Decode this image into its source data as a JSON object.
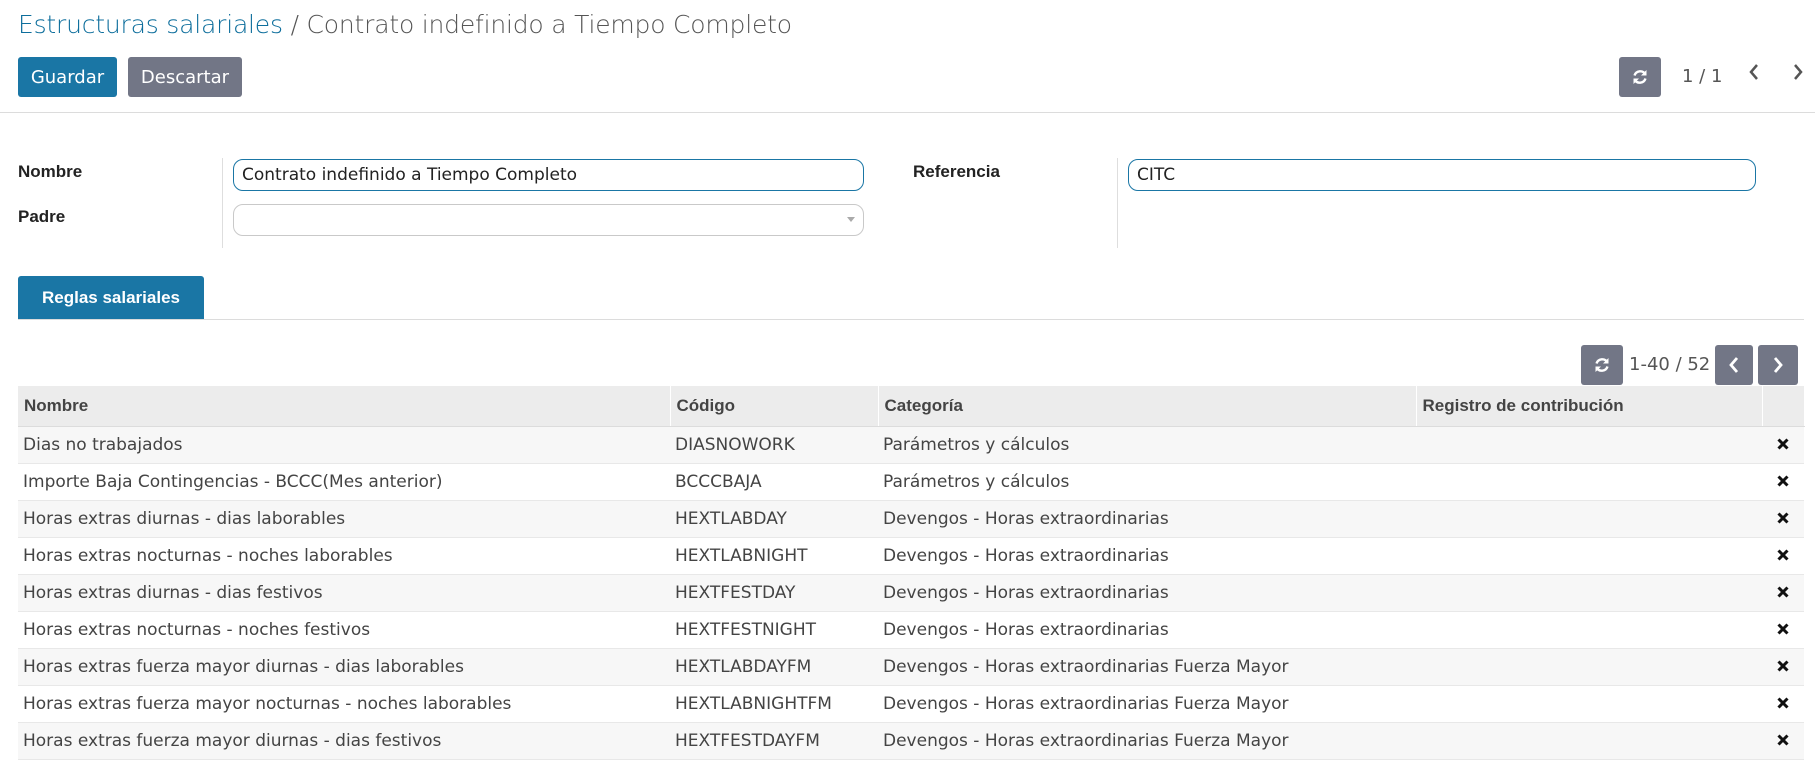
{
  "breadcrumb": {
    "parent": "Estructuras salariales",
    "separator": " / ",
    "current": "Contrato indefinido a Tiempo Completo"
  },
  "toolbar": {
    "save_label": "Guardar",
    "discard_label": "Descartar",
    "refresh_icon": "refresh-icon",
    "pager": "1 / 1"
  },
  "form": {
    "name_label": "Nombre",
    "name_value": "Contrato indefinido a Tiempo Completo",
    "parent_label": "Padre",
    "parent_value": "",
    "reference_label": "Referencia",
    "reference_value": "CITC"
  },
  "tabs": [
    {
      "label": "Reglas salariales",
      "active": true
    }
  ],
  "list": {
    "pager": "1-40 / 52",
    "columns": [
      "Nombre",
      "Código",
      "Categoría",
      "Registro de contribución",
      ""
    ],
    "rows": [
      {
        "name": "Dias no trabajados",
        "code": "DIASNOWORK",
        "category": "Parámetros y cálculos",
        "contribution": ""
      },
      {
        "name": "Importe Baja Contingencias - BCCC(Mes anterior)",
        "code": "BCCCBAJA",
        "category": "Parámetros y cálculos",
        "contribution": ""
      },
      {
        "name": "Horas extras diurnas - dias laborables",
        "code": "HEXTLABDAY",
        "category": "Devengos - Horas extraordinarias",
        "contribution": ""
      },
      {
        "name": "Horas extras nocturnas - noches laborables",
        "code": "HEXTLABNIGHT",
        "category": "Devengos - Horas extraordinarias",
        "contribution": ""
      },
      {
        "name": "Horas extras diurnas - dias festivos",
        "code": "HEXTFESTDAY",
        "category": "Devengos - Horas extraordinarias",
        "contribution": ""
      },
      {
        "name": "Horas extras nocturnas - noches festivos",
        "code": "HEXTFESTNIGHT",
        "category": "Devengos - Horas extraordinarias",
        "contribution": ""
      },
      {
        "name": "Horas extras fuerza mayor diurnas - dias laborables",
        "code": "HEXTLABDAYFM",
        "category": "Devengos - Horas extraordinarias Fuerza Mayor",
        "contribution": ""
      },
      {
        "name": "Horas extras fuerza mayor nocturnas - noches laborables",
        "code": "HEXTLABNIGHTFM",
        "category": "Devengos - Horas extraordinarias Fuerza Mayor",
        "contribution": ""
      },
      {
        "name": "Horas extras fuerza mayor diurnas - dias festivos",
        "code": "HEXTFESTDAYFM",
        "category": "Devengos - Horas extraordinarias Fuerza Mayor",
        "contribution": ""
      }
    ],
    "delete_icon": "delete-icon"
  },
  "colors": {
    "primary": "#1a76a5",
    "secondary": "#727686",
    "link": "#0d6e9c"
  }
}
